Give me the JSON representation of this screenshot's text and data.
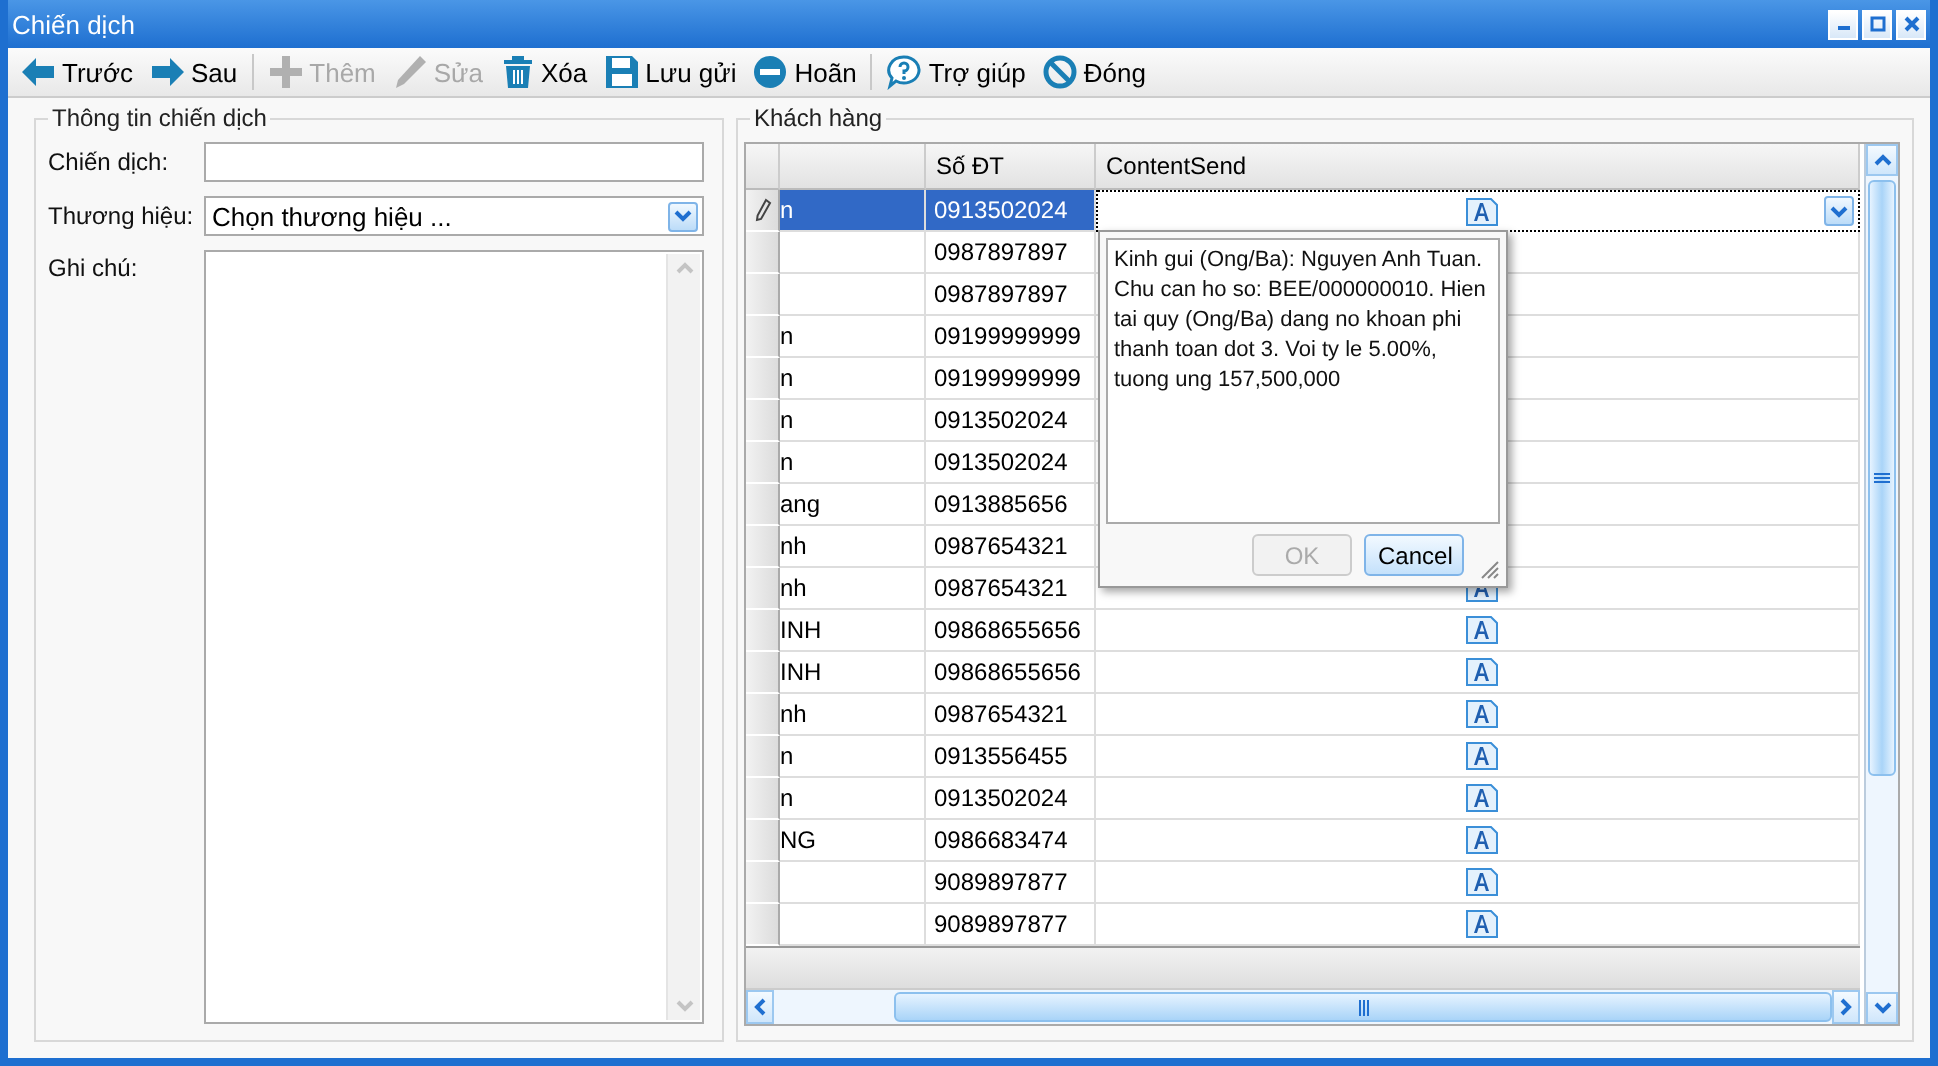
{
  "window": {
    "title": "Chiến dịch"
  },
  "toolbar": {
    "groups": [
      [
        {
          "label": "Trước",
          "disabled": false
        },
        {
          "label": "Sau",
          "disabled": false
        }
      ],
      [
        {
          "label": "Thêm",
          "disabled": true
        },
        {
          "label": "Sửa",
          "disabled": true
        },
        {
          "label": "Xóa",
          "disabled": false
        },
        {
          "label": "Lưu gửi",
          "disabled": false
        },
        {
          "label": "Hoãn",
          "disabled": false
        }
      ],
      [
        {
          "label": "Trợ giúp",
          "disabled": false
        },
        {
          "label": "Đóng",
          "disabled": false
        }
      ]
    ]
  },
  "campaign_info": {
    "title": "Thông tin chiến dịch",
    "campaign_label": "Chiến dịch:",
    "brand_label": "Thương hiệu:",
    "brand_value": "Chọn thương hiệu ...",
    "note_label": "Ghi chú:"
  },
  "customers": {
    "title": "Khách hàng",
    "columns": [
      "Số ĐT",
      "ContentSend"
    ],
    "rows": [
      {
        "name": "n",
        "phone": "0913502024",
        "selected": true,
        "content_icon": true
      },
      {
        "phone": "0987897897",
        "selected": false,
        "content_icon": false
      },
      {
        "phone": "0987897897",
        "selected": false,
        "content_icon": false
      },
      {
        "name": "n",
        "phone": "09199999999",
        "selected": false,
        "content_icon": false
      },
      {
        "name": "n",
        "phone": "09199999999",
        "selected": false,
        "content_icon": false
      },
      {
        "name": "n",
        "phone": "0913502024",
        "selected": false,
        "content_icon": false
      },
      {
        "name": "n",
        "phone": "0913502024",
        "selected": false,
        "content_icon": false
      },
      {
        "name": "ang",
        "phone": "0913885656",
        "selected": false,
        "content_icon": false
      },
      {
        "name": "nh",
        "phone": "0987654321",
        "selected": false,
        "content_icon": false
      },
      {
        "name": "nh",
        "phone": "0987654321",
        "selected": false,
        "content_icon": true
      },
      {
        "name": "INH",
        "phone": "09868655656",
        "selected": false,
        "content_icon": true
      },
      {
        "name": "INH",
        "phone": "09868655656",
        "selected": false,
        "content_icon": true
      },
      {
        "name": "nh",
        "phone": "0987654321",
        "selected": false,
        "content_icon": true
      },
      {
        "name": "n",
        "phone": "0913556455",
        "selected": false,
        "content_icon": true
      },
      {
        "name": "n",
        "phone": "0913502024",
        "selected": false,
        "content_icon": true
      },
      {
        "name": "NG",
        "phone": "0986683474",
        "selected": false,
        "content_icon": true
      },
      {
        "phone": "9089897877",
        "selected": false,
        "content_icon": true
      },
      {
        "phone": "9089897877",
        "selected": false,
        "content_icon": true
      }
    ]
  },
  "content_popup": {
    "text": "Kinh gui (Ong/Ba): Nguyen Anh Tuan. Chu can ho so: BEE/000000010. Hien tai quy (Ong/Ba) dang no khoan phi thanh toan dot 3. Voi ty le 5.00%, tuong ung 157,500,000",
    "buttons": [
      {
        "label": "OK",
        "disabled": true
      },
      {
        "label": "Cancel",
        "disabled": false
      }
    ]
  }
}
